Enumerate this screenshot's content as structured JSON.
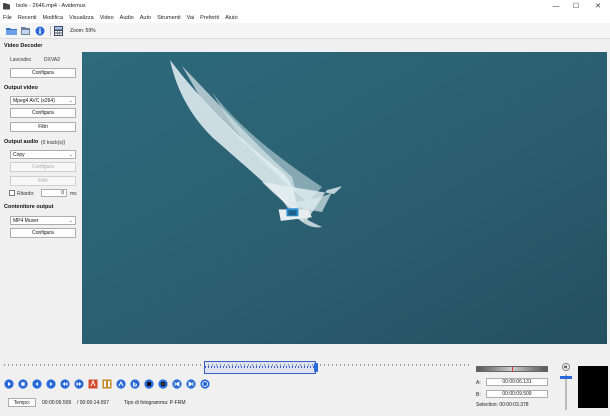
{
  "window": {
    "title": "Isole - 2646.mp4 - Avidemux",
    "min": "—",
    "max": "☐",
    "close": "✕"
  },
  "menu": [
    "File",
    "Recenti",
    "Modifica",
    "Visualizza",
    "Video",
    "Audio",
    "Auto",
    "Strumenti",
    "Vai",
    "Preferiti",
    "Aiuto"
  ],
  "toolbar": {
    "zoom": "Zoom: 59%"
  },
  "left": {
    "video_decoder": {
      "title": "Video Decoder",
      "lavcodec_label": "Lavcodec",
      "codec": "DXVA2",
      "configure": "Configura"
    },
    "output_video": {
      "title": "Output video",
      "codec": "Mpeg4 AVC (x264)",
      "configure": "Configura",
      "filters": "Filtri"
    },
    "output_audio": {
      "title": "Output audio",
      "tracks": "(0 track(s))",
      "codec": "Copy",
      "configure": "Configura",
      "filters": "Filtri",
      "delay_label": "Ritardo:",
      "delay_value": "0",
      "delay_unit": "ms"
    },
    "container": {
      "title": "Contenitore output",
      "format": "MP4 Muxer",
      "configure": "Configura"
    }
  },
  "status": {
    "time_button": "Tempo:",
    "current_time": "00:00:09.509",
    "total_time": "/ 00:00:14.097",
    "frame_type": "Tipo di fotogramma:  P-FRM"
  },
  "markers": {
    "a_label": "A:",
    "a_value": "00:00:06.131",
    "b_label": "B:",
    "b_value": "00:00:09.509",
    "selection": "Selection: 00:00:03.378"
  },
  "colors": {
    "sea": "#2c6274",
    "accent": "#2a6ad8",
    "selection": "#3b5fc9"
  }
}
